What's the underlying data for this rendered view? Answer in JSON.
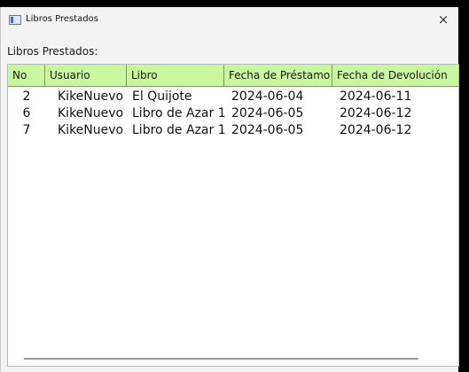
{
  "window": {
    "title": "Libros Prestados",
    "close_glyph": "×",
    "app_icon": "window-app-icon"
  },
  "section_label": "Libros Prestados:",
  "table": {
    "header_color": "#c8f7a0",
    "headers": [
      "No",
      "Usuario",
      "Libro",
      "Fecha de Préstamo",
      "Fecha de Devolución"
    ],
    "rows": [
      [
        "2",
        "KikeNuevo",
        "El Quijote",
        "2024-06-04",
        "2024-06-11"
      ],
      [
        "6",
        "KikeNuevo",
        "Libro de Azar 1",
        "2024-06-05",
        "2024-06-12"
      ],
      [
        "7",
        "KikeNuevo",
        "Libro de Azar 1",
        "2024-06-05",
        "2024-06-12"
      ]
    ]
  }
}
